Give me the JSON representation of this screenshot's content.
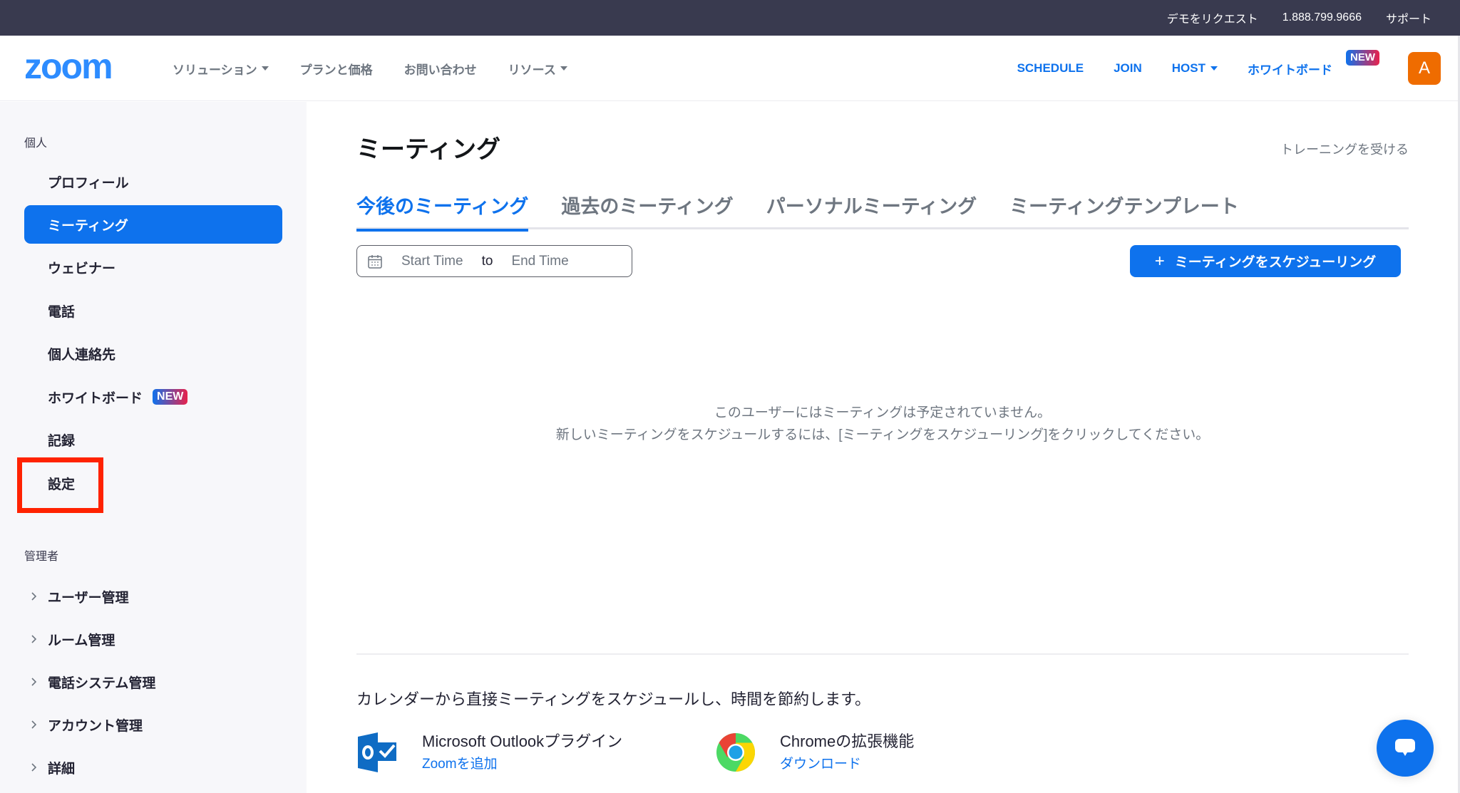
{
  "topbar": {
    "links": [
      "デモをリクエスト",
      "1.888.799.9666",
      "サポート"
    ]
  },
  "nav": {
    "logo": "zoom",
    "left_items": [
      {
        "label": "ソリューション",
        "dropdown": true
      },
      {
        "label": "プランと価格",
        "dropdown": false
      },
      {
        "label": "お問い合わせ",
        "dropdown": false
      },
      {
        "label": "リソース",
        "dropdown": true
      }
    ],
    "right_items": {
      "schedule": "SCHEDULE",
      "join": "JOIN",
      "host": "HOST",
      "whiteboard": "ホワイトボード",
      "whiteboard_badge": "NEW"
    },
    "avatar_initial": "A",
    "avatar_color": "#EF6C00"
  },
  "sidebar": {
    "personal_label": "個人",
    "personal_items": [
      {
        "label": "プロフィール",
        "active": false
      },
      {
        "label": "ミーティング",
        "active": true
      },
      {
        "label": "ウェビナー",
        "active": false
      },
      {
        "label": "電話",
        "active": false
      },
      {
        "label": "個人連絡先",
        "active": false
      },
      {
        "label": "ホワイトボード",
        "active": false,
        "badge": "NEW"
      },
      {
        "label": "記録",
        "active": false
      },
      {
        "label": "設定",
        "active": false,
        "highlighted": true
      }
    ],
    "admin_label": "管理者",
    "admin_items": [
      {
        "label": "ユーザー管理"
      },
      {
        "label": "ルーム管理"
      },
      {
        "label": "電話システム管理"
      },
      {
        "label": "アカウント管理"
      },
      {
        "label": "詳細"
      }
    ]
  },
  "main": {
    "title": "ミーティング",
    "training_link": "トレーニングを受ける",
    "tabs": [
      {
        "label": "今後のミーティング",
        "active": true
      },
      {
        "label": "過去のミーティング",
        "active": false
      },
      {
        "label": "パーソナルミーティング",
        "active": false
      },
      {
        "label": "ミーティングテンプレート",
        "active": false
      }
    ],
    "date_range": {
      "start_placeholder": "Start Time",
      "separator": "to",
      "end_placeholder": "End Time"
    },
    "schedule_button": "ミーティングをスケジューリング",
    "empty_line1": "このユーザーにはミーティングは予定されていません。",
    "empty_line2": "新しいミーティングをスケジュールするには、[ミーティングをスケジューリング]をクリックしてください。",
    "calendar_text": "カレンダーから直接ミーティングをスケジュールし、時間を節約します。",
    "plugins": [
      {
        "title": "Microsoft Outlookプラグイン",
        "link": "Zoomを追加",
        "icon": "outlook-icon"
      },
      {
        "title": "Chromeの拡張機能",
        "link": "ダウンロード",
        "icon": "chrome-icon"
      }
    ]
  },
  "colors": {
    "brand_blue": "#0E72ED",
    "topbar": "#393A4F",
    "highlight_box": "#FF2200"
  }
}
